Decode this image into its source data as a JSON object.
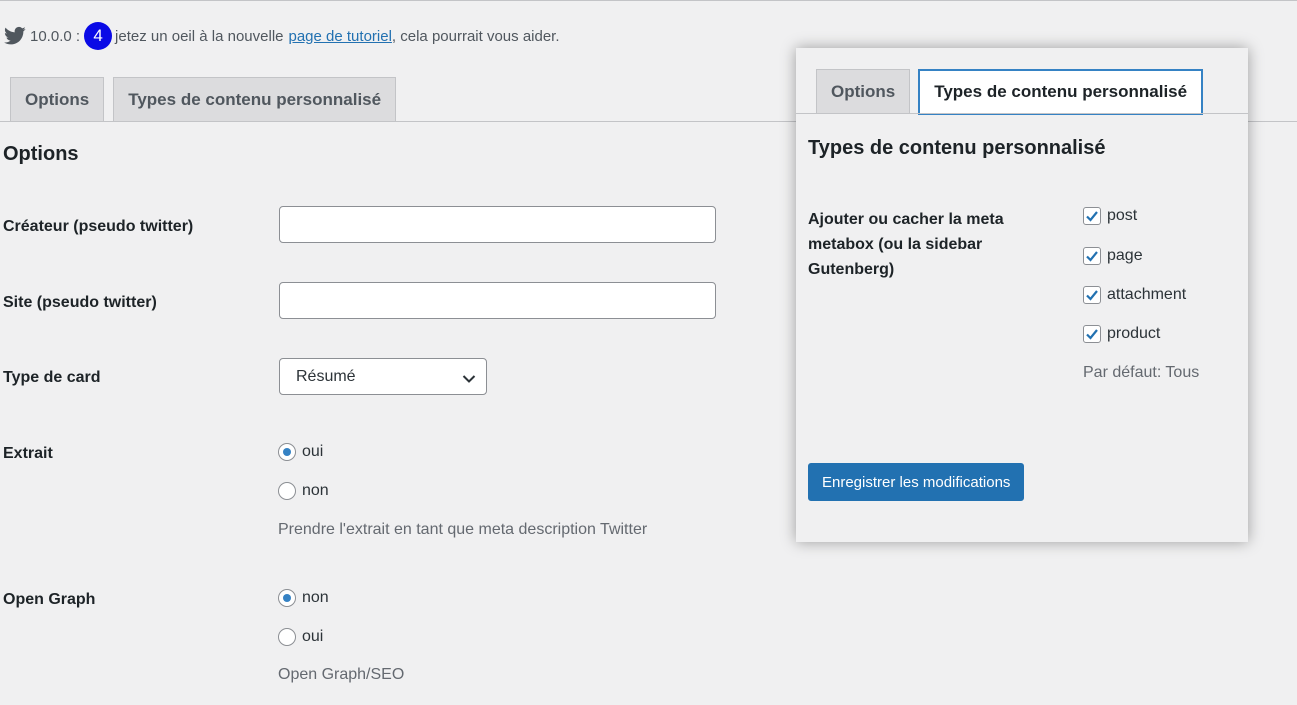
{
  "notice": {
    "icon": "twitter-bird-icon",
    "version": "10.0.0 :",
    "badge": "4",
    "text_before": "jetez un oeil à la nouvelle",
    "link": "page de tutoriel",
    "text_after": ", cela pourrait vous aider."
  },
  "tabs": [
    {
      "label": "Options"
    },
    {
      "label": "Types de contenu personnalisé"
    }
  ],
  "options": {
    "title": "Options",
    "creator": {
      "label": "Créateur (pseudo twitter)",
      "value": ""
    },
    "site": {
      "label": "Site (pseudo twitter)",
      "value": ""
    },
    "card": {
      "label": "Type de card",
      "selected": "Résumé"
    },
    "excerpt": {
      "label": "Extrait",
      "choices": [
        {
          "label": "oui",
          "checked": true
        },
        {
          "label": "non",
          "checked": false
        }
      ],
      "description": "Prendre l'extrait en tant que meta description Twitter"
    },
    "opengraph": {
      "label": "Open Graph",
      "choices": [
        {
          "label": "non",
          "checked": true
        },
        {
          "label": "oui",
          "checked": false
        }
      ],
      "description": "Open Graph/SEO"
    }
  },
  "panel": {
    "tabs": [
      {
        "label": "Options",
        "active": false
      },
      {
        "label": "Types de contenu personnalisé",
        "active": true
      }
    ],
    "title": "Types de contenu personnalisé",
    "label": "Ajouter ou cacher la meta metabox (ou la sidebar Gutenberg)",
    "post_types": [
      {
        "label": "post",
        "checked": true
      },
      {
        "label": "page",
        "checked": true
      },
      {
        "label": "attachment",
        "checked": true
      },
      {
        "label": "product",
        "checked": true
      }
    ],
    "default_text": "Par défaut: Tous",
    "save_label": "Enregistrer les modifications"
  },
  "colors": {
    "primary": "#2271b1",
    "badge": "#0a0ae6",
    "background": "#f0f0f1"
  }
}
